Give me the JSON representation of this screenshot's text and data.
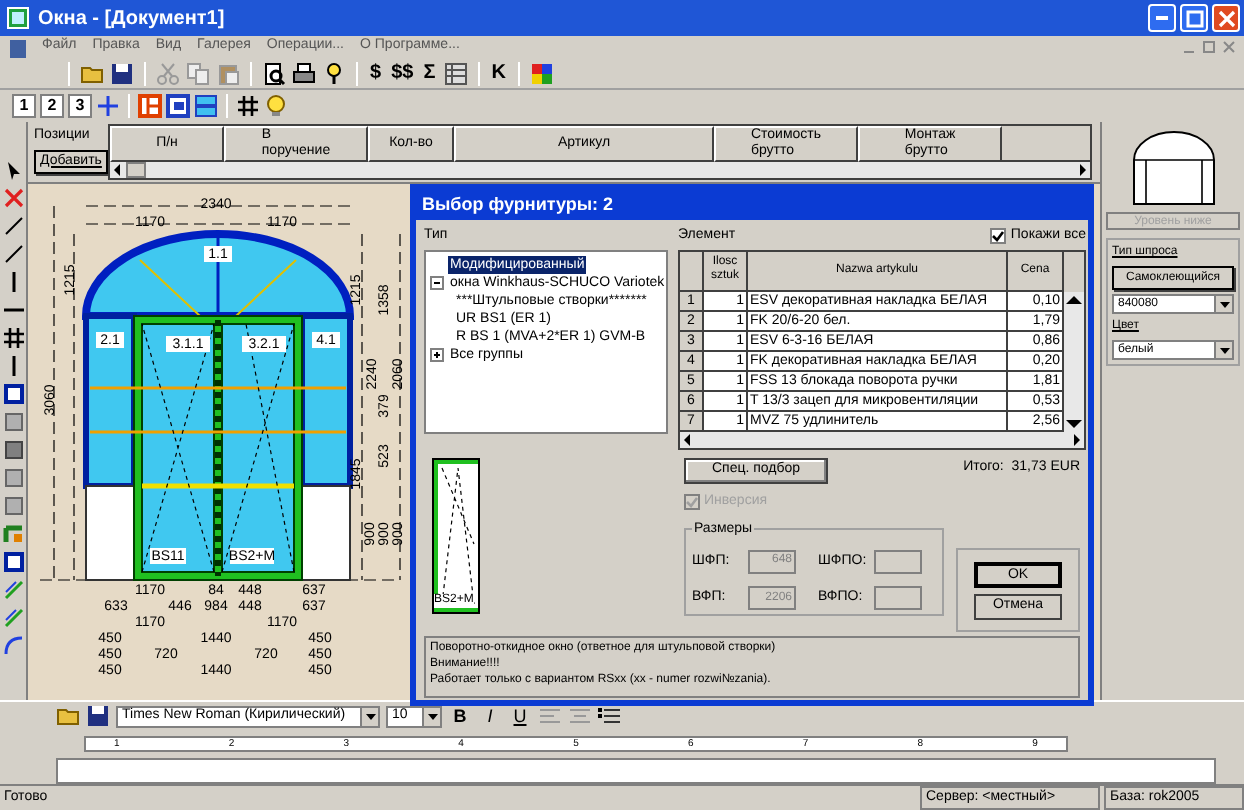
{
  "window": {
    "title": "Окна - [Документ1]"
  },
  "menu": [
    "Файл",
    "Правка",
    "Вид",
    "Галерея",
    "Операции...",
    "О Программе..."
  ],
  "toolbar_1": [
    {
      "label": "$"
    },
    {
      "label": "$$"
    },
    {
      "label": "Σ"
    },
    {
      "label": "K"
    }
  ],
  "toolbar_2": [
    "1",
    "2",
    "3"
  ],
  "positions_panel": {
    "label": "Позиции",
    "add_button": "Добавить"
  },
  "grid": {
    "columns": [
      {
        "lines": [
          "П/н"
        ]
      },
      {
        "lines": [
          "В",
          "поручение"
        ]
      },
      {
        "lines": [
          "Кол-во"
        ]
      },
      {
        "lines": [
          "Артикул"
        ]
      },
      {
        "lines": [
          "Стоимость",
          "брутто"
        ]
      },
      {
        "lines": [
          "Монтаж",
          "брутто"
        ]
      }
    ]
  },
  "drawing": {
    "top_dims": [
      "2340",
      "1170",
      "1170"
    ],
    "left_dims": [
      "1215",
      "3060"
    ],
    "right_dims": [
      "1215",
      "1358",
      "2240",
      "2060",
      "379",
      "523",
      "1845",
      "900",
      "900",
      "900"
    ],
    "bottom_rows": [
      [
        "1170",
        "84",
        "448",
        "637"
      ],
      [
        "633",
        "446",
        "984",
        "448",
        "637"
      ],
      [
        "1170",
        "1170"
      ],
      [
        "450",
        "1440",
        "450"
      ],
      [
        "450",
        "720",
        "720",
        "450"
      ],
      [
        "450",
        "1440",
        "450"
      ]
    ],
    "pane_labels": [
      "1.1",
      "2.1",
      "4.1",
      "3.1.1",
      "3.2.1",
      "BS11",
      "BS2+M"
    ]
  },
  "dialog": {
    "title": "Выбор фурнитуры: 2",
    "type_label": "Тип",
    "tree": [
      {
        "label": "Модифицированный",
        "selected": true
      },
      {
        "label": "окна Winkhaus-SCHUCO Variotek",
        "selected": false,
        "expanded": true,
        "children": [
          {
            "label": "***Штульповые створки*******",
            "selected": false
          },
          {
            "label": "UR BS1 (ER 1)",
            "selected": false
          },
          {
            "label": "R BS 1 (MVA+2*ER 1) GVM-B",
            "selected": false
          }
        ]
      },
      {
        "label": "Все группы",
        "selected": false,
        "expanded": false
      }
    ],
    "element_label": "Элемент",
    "show_all": {
      "label": "Покажи все",
      "checked": true
    },
    "table": {
      "columns": [
        "",
        "Ilosc sztuk",
        "Nazwa artykulu",
        "Cena"
      ],
      "rows": [
        {
          "cells": [
            "1",
            "1",
            "ESV декоративная накладка БЕЛАЯ",
            "0,10"
          ]
        },
        {
          "cells": [
            "2",
            "1",
            "FK 20/6-20 бел.",
            "1,79"
          ]
        },
        {
          "cells": [
            "3",
            "1",
            "ESV 6-3-16  БЕЛАЯ",
            "0,86"
          ]
        },
        {
          "cells": [
            "4",
            "1",
            "FK декоративная накладка БЕЛАЯ",
            "0,20"
          ]
        },
        {
          "cells": [
            "5",
            "1",
            "FSS 13 блокада поворота ручки",
            "1,81"
          ]
        },
        {
          "cells": [
            "6",
            "1",
            "T 13/3 зацеп для микровентиляции",
            "0,53"
          ]
        },
        {
          "cells": [
            "7",
            "1",
            "MVZ 75 удлинитель",
            "2,56"
          ]
        }
      ]
    },
    "preview_label": "BS2+M",
    "special_button": "Спец. подбор",
    "total": "Итого:  31,73 EUR",
    "inversion": {
      "label": "Инверсия",
      "checked": true,
      "disabled": true
    },
    "sizes": {
      "title": "Размеры",
      "fields": [
        {
          "label": "ШФП:",
          "value": "648",
          "disabled": true
        },
        {
          "label": "ШФПО:"
        },
        {
          "label": "ВФП:",
          "value": "2206",
          "disabled": true
        },
        {
          "label": "ВФПО:"
        }
      ]
    },
    "ok_button": "OK",
    "cancel_button": "Отмена",
    "memo": {
      "lines": [
        "Поворотно-откидное окно (ответное для штульповой створки)",
        "Внимание!!!!",
        "Работает только с вариантом RSxx (xx - numer rozwi№zania)."
      ]
    }
  },
  "right_panel": {
    "level_down": {
      "label": "Уровень ниже",
      "disabled": true
    },
    "bar_type_label": "Тип шпроса",
    "bar_type_button": "Самоклеющийся",
    "profile_combo": "840080",
    "color_label": "Цвет",
    "color_combo": "белый"
  },
  "editor": {
    "font": "Times New Roman (Кирилический)",
    "size": "10",
    "format_buttons": [
      {
        "label": "B",
        "kind": "bold"
      },
      {
        "label": "I",
        "kind": "italic"
      },
      {
        "label": "U",
        "kind": "underline"
      }
    ],
    "ruler": [
      "1",
      "2",
      "3",
      "4",
      "5",
      "6",
      "7",
      "8",
      "9"
    ]
  },
  "status_bar": [
    "Готово",
    "Сервер: <местный>",
    "База: rok2005"
  ]
}
